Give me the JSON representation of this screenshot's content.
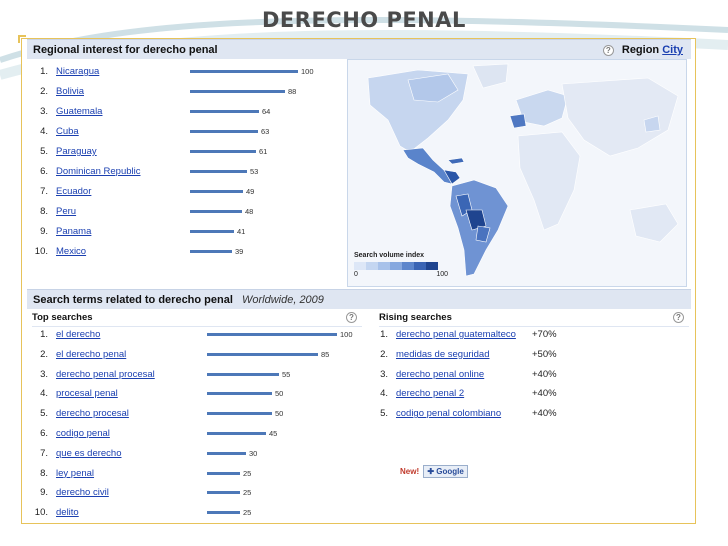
{
  "slide": {
    "title": "DERECHO PENAL"
  },
  "regional": {
    "header": "Regional interest for derecho penal",
    "help": "?",
    "region_label": "Region",
    "region_link": "City",
    "items": [
      {
        "rank": "1.",
        "name": "Nicaragua",
        "value": 100
      },
      {
        "rank": "2.",
        "name": "Bolivia",
        "value": 88
      },
      {
        "rank": "3.",
        "name": "Guatemala",
        "value": 64
      },
      {
        "rank": "4.",
        "name": "Cuba",
        "value": 63
      },
      {
        "rank": "5.",
        "name": "Paraguay",
        "value": 61
      },
      {
        "rank": "6.",
        "name": "Dominican Republic",
        "value": 53
      },
      {
        "rank": "7.",
        "name": "Ecuador",
        "value": 49
      },
      {
        "rank": "8.",
        "name": "Peru",
        "value": 48
      },
      {
        "rank": "9.",
        "name": "Panama",
        "value": 41
      },
      {
        "rank": "10.",
        "name": "Mexico",
        "value": 39
      }
    ],
    "legend": {
      "title": "Search volume index",
      "min": "0",
      "max": "100",
      "colors": [
        "#dde7f7",
        "#c4d6f1",
        "#a8c2ea",
        "#86a8df",
        "#5d86cc",
        "#3a64b4",
        "#1f448f"
      ]
    }
  },
  "related": {
    "header": "Search terms related to derecho penal",
    "scope": "Worldwide, 2009",
    "top": {
      "title": "Top searches",
      "help": "?",
      "items": [
        {
          "rank": "1.",
          "term": "el derecho",
          "value": 100
        },
        {
          "rank": "2.",
          "term": "el derecho penal",
          "value": 85
        },
        {
          "rank": "3.",
          "term": "derecho penal procesal",
          "value": 55
        },
        {
          "rank": "4.",
          "term": "procesal penal",
          "value": 50
        },
        {
          "rank": "5.",
          "term": "derecho procesal",
          "value": 50
        },
        {
          "rank": "6.",
          "term": "codigo penal",
          "value": 45
        },
        {
          "rank": "7.",
          "term": "que es derecho",
          "value": 30
        },
        {
          "rank": "8.",
          "term": "ley penal",
          "value": 25
        },
        {
          "rank": "9.",
          "term": "derecho civil",
          "value": 25
        },
        {
          "rank": "10.",
          "term": "delito",
          "value": 25
        }
      ]
    },
    "rising": {
      "title": "Rising searches",
      "help": "?",
      "items": [
        {
          "rank": "1.",
          "term": "derecho penal guatemalteco",
          "change": "+70%"
        },
        {
          "rank": "2.",
          "term": "medidas de seguridad",
          "change": "+50%"
        },
        {
          "rank": "3.",
          "term": "derecho penal online",
          "change": "+40%"
        },
        {
          "rank": "4.",
          "term": "derecho penal 2",
          "change": "+40%"
        },
        {
          "rank": "5.",
          "term": "codigo penal colombiano",
          "change": "+40%"
        }
      ],
      "new_label": "New!",
      "google_button": "Google"
    }
  }
}
